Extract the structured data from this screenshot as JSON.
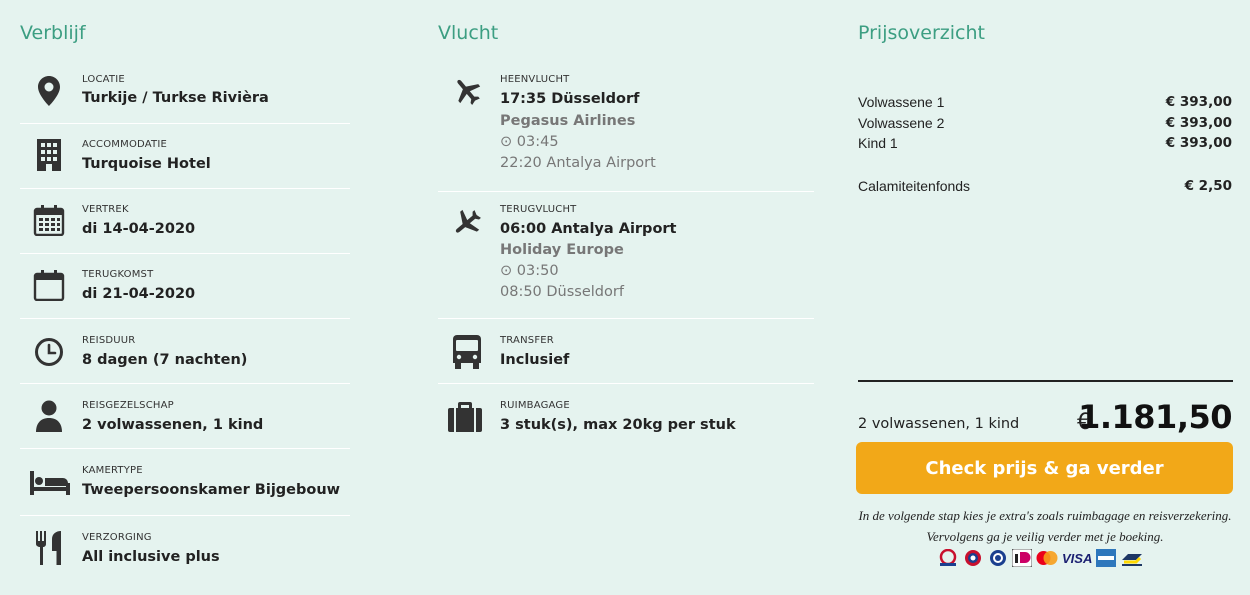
{
  "verblijf": {
    "title": "Verblijf",
    "items": [
      {
        "label": "LOCATIE",
        "value": "Turkije / Turkse Rivièra",
        "icon": "location-pin-icon"
      },
      {
        "label": "ACCOMMODATIE",
        "value": "Turquoise Hotel",
        "icon": "building-icon"
      },
      {
        "label": "VERTREK",
        "value": "di 14-04-2020",
        "icon": "calendar-icon"
      },
      {
        "label": "TERUGKOMST",
        "value": "di 21-04-2020",
        "icon": "calendar-empty-icon"
      },
      {
        "label": "REISDUUR",
        "value": "8 dagen (7 nachten)",
        "icon": "clock-icon"
      },
      {
        "label": "REISGEZELSCHAP",
        "value": "2 volwassenen, 1 kind",
        "icon": "person-icon"
      },
      {
        "label": "KAMERTYPE",
        "value": "Tweepersoonskamer Bijgebouw",
        "icon": "bed-icon"
      },
      {
        "label": "VERZORGING",
        "value": "All inclusive plus",
        "icon": "cutlery-icon"
      }
    ]
  },
  "vlucht": {
    "title": "Vlucht",
    "outbound": {
      "label": "HEENVLUCHT",
      "departure": "17:35 Düsseldorf",
      "airline": "Pegasus Airlines",
      "duration": "⊙ 03:45",
      "arrival": "22:20 Antalya Airport",
      "icon": "plane-icon"
    },
    "inbound": {
      "label": "TERUGVLUCHT",
      "departure": "06:00 Antalya Airport",
      "airline": "Holiday Europe",
      "duration": "⊙ 03:50",
      "arrival": "08:50 Düsseldorf",
      "icon": "plane-return-icon"
    },
    "transfer": {
      "label": "TRANSFER",
      "value": "Inclusief",
      "icon": "bus-icon"
    },
    "baggage": {
      "label": "RUIMBAGAGE",
      "value": "3 stuk(s), max 20kg per stuk",
      "icon": "suitcase-icon"
    }
  },
  "prijs": {
    "title": "Prijsoverzicht",
    "rows": [
      {
        "label": "Volwassene 1",
        "amount": "€ 393,00"
      },
      {
        "label": "Volwassene 2",
        "amount": "€ 393,00"
      },
      {
        "label": "Kind 1",
        "amount": "€ 393,00"
      }
    ],
    "fee": {
      "label": "Calamiteitenfonds",
      "amount": "€ 2,50"
    },
    "total_party": "2 volwassenen, 1 kind",
    "currency": "€",
    "total": "1.181,50",
    "cta": "Check prijs & ga verder",
    "note": "In de volgende stap kies je extra's zoals ruimbagage en reisverzekering. Vervolgens ga je veilig verder met je boeking.",
    "payment_methods": [
      "sgr-icon",
      "anvr-icon",
      "calamiteitenfonds-icon",
      "ideal-icon",
      "mastercard-icon",
      "visa-icon",
      "amex-icon",
      "bancontact-icon"
    ],
    "payment_visa_label": "VISA"
  },
  "colors": {
    "background": "#e5f3ef",
    "accent": "#3c9e82",
    "cta": "#f2a818"
  }
}
